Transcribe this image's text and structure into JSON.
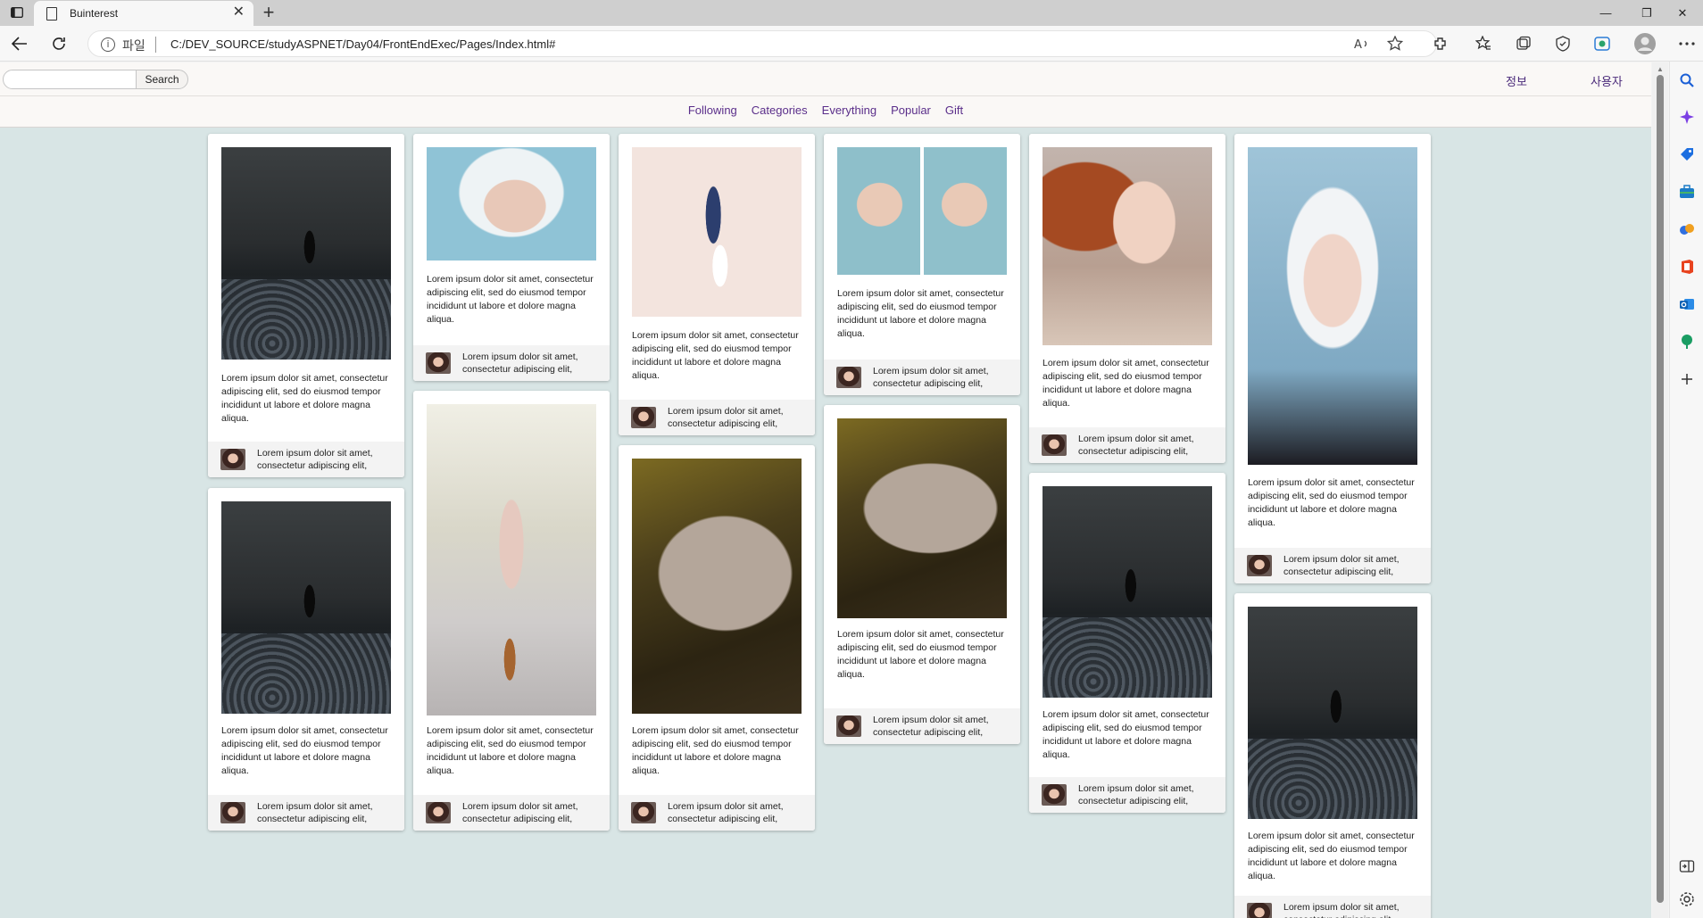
{
  "browser": {
    "tab_title": "Buinterest",
    "address_scheme": "파일",
    "address_url": "C:/DEV_SOURCE/studyASPNET/Day04/FrontEndExec/Pages/Index.html#"
  },
  "header": {
    "search_placeholder": "",
    "search_button": "Search",
    "link_info": "정보",
    "link_user": "사용자"
  },
  "nav": {
    "items": [
      "Following",
      "Categories",
      "Everything",
      "Popular",
      "Gift"
    ]
  },
  "pin_text": {
    "description": "Lorem ipsum dolor sit amet, consectetur adipiscing elit, sed do eiusmod tempor incididunt ut labore et dolore magna aliqua.",
    "footer": "Lorem ipsum dolor sit amet, consectetur adipiscing elit,"
  },
  "pins": [
    {
      "image": "dark-corridor-figure"
    },
    {
      "image": "dark-corridor-figure"
    },
    {
      "image": "white-haired-woman"
    },
    {
      "image": "woman-walking-road"
    },
    {
      "image": "woman-jumping"
    },
    {
      "image": "climber-on-rock"
    },
    {
      "image": "two-faces-duckface"
    },
    {
      "image": "climber-on-rock"
    },
    {
      "image": "redhead-woman"
    },
    {
      "image": "dark-corridor-figure"
    },
    {
      "image": "white-haired-woman-portrait"
    },
    {
      "image": "dark-corridor-figure"
    }
  ]
}
